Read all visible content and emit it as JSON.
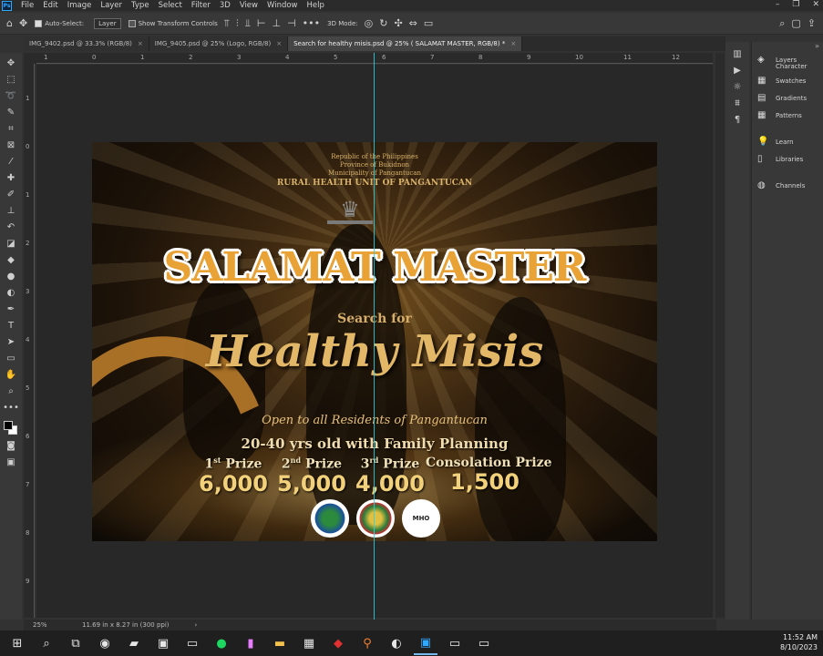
{
  "menubar": {
    "app_icon": "Ps",
    "items": [
      "File",
      "Edit",
      "Image",
      "Layer",
      "Type",
      "Select",
      "Filter",
      "3D",
      "View",
      "Window",
      "Help"
    ],
    "window_controls": [
      "–",
      "❐",
      "✕"
    ]
  },
  "options": {
    "auto_select_label": "Auto-Select:",
    "auto_select_checked": true,
    "layer_select": "Layer",
    "show_transform_label": "Show Transform Controls",
    "mode_3d_label": "3D Mode:"
  },
  "tabs": [
    {
      "label": "IMG_9402.psd @ 33.3% (RGB/8)",
      "active": false
    },
    {
      "label": "IMG_9405.psd @ 25% (Logo, RGB/8)",
      "active": false
    },
    {
      "label": "Search for healthy misis.psd @ 25% ( SALAMAT MASTER, RGB/8) *",
      "active": true
    }
  ],
  "ruler": {
    "h": [
      "1",
      "0",
      "1",
      "2",
      "3",
      "4",
      "5",
      "6",
      "7",
      "8",
      "9",
      "10",
      "11",
      "12"
    ],
    "v": [
      "1",
      "0",
      "1",
      "2",
      "3",
      "4",
      "5",
      "6",
      "7",
      "8",
      "9"
    ]
  },
  "panels": {
    "items": [
      {
        "label": "Layers",
        "icon": "layers-icon"
      },
      {
        "label": "Character",
        "icon": "character-icon"
      },
      {
        "label": "Swatches",
        "icon": "swatches-icon"
      },
      {
        "label": "Gradients",
        "icon": "gradients-icon"
      },
      {
        "label": "Patterns",
        "icon": "patterns-icon"
      },
      {
        "label": "Learn",
        "icon": "learn-icon"
      },
      {
        "label": "Libraries",
        "icon": "libraries-icon"
      },
      {
        "label": "Channels",
        "icon": "channels-icon"
      }
    ]
  },
  "poster": {
    "header1": "Republic of the Philippines",
    "header2": "Province of Bukidnon",
    "header3": "Municipality of Pangantucan",
    "header4": "RURAL HEALTH UNIT OF PANGANTUCAN",
    "title": "SALAMAT MASTER",
    "search_for": "Search for",
    "healthy_misis": "Healthy Misis",
    "open_to": "Open to all Residents of Pangantucan",
    "age": "20-40 yrs old with Family Planning",
    "prizes": [
      {
        "num": "1",
        "sup": "st",
        "label": "Prize",
        "amount": "6,000"
      },
      {
        "num": "2",
        "sup": "nd",
        "label": "Prize",
        "amount": "5,000"
      },
      {
        "num": "3",
        "sup": "rd",
        "label": "Prize",
        "amount": "4,000"
      },
      {
        "num": "",
        "sup": "",
        "label": "Consolation Prize",
        "amount": "1,500"
      }
    ],
    "seal3_text": "MHO"
  },
  "status": {
    "zoom": "25%",
    "doc_size": "11.69 in x 8.27 in (300 ppi)"
  },
  "tray": {
    "time": "11:52 AM",
    "date": "8/10/2023"
  },
  "colors": {
    "ps_accent": "#31a8ff",
    "guide": "#2fd0e0",
    "poster_gold": "#e8a236"
  }
}
